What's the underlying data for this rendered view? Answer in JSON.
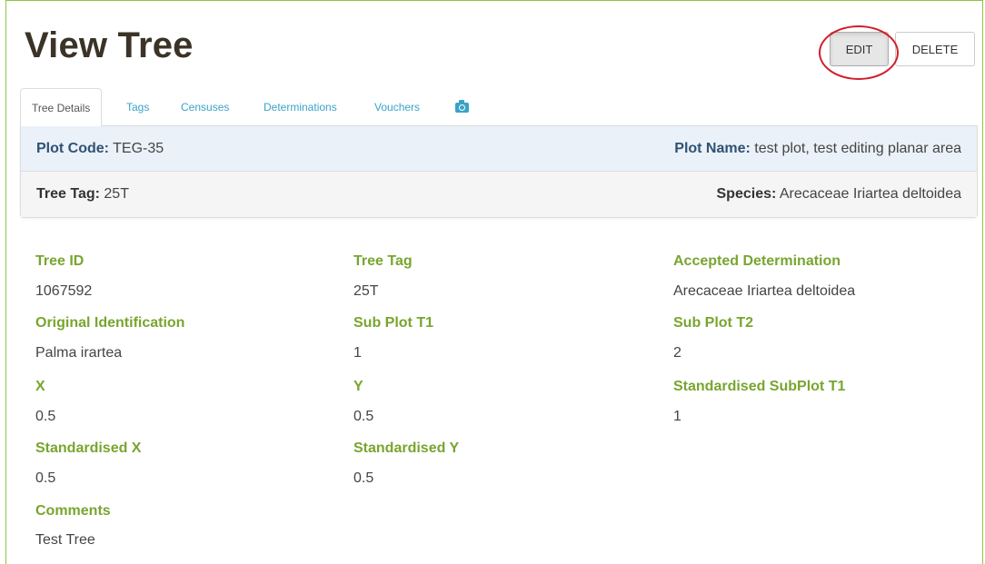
{
  "page": {
    "title": "View Tree",
    "edit_label": "EDIT",
    "delete_label": "DELETE"
  },
  "tabs": [
    {
      "label": "Tree Details",
      "active": true
    },
    {
      "label": "Tags",
      "active": false
    },
    {
      "label": "Censuses",
      "active": false
    },
    {
      "label": "Determinations",
      "active": false
    },
    {
      "label": "Vouchers",
      "active": false
    },
    {
      "icon": "camera-icon",
      "active": false
    }
  ],
  "summary": {
    "plot_code_label": "Plot Code:",
    "plot_code": "TEG-35",
    "plot_name_label": "Plot Name:",
    "plot_name": "test plot, test editing planar area",
    "tree_tag_label": "Tree Tag:",
    "tree_tag": "25T",
    "species_label": "Species:",
    "species": "Arecaceae Iriartea deltoidea"
  },
  "details": {
    "tree_id": {
      "label": "Tree ID",
      "value": "1067592"
    },
    "tree_tag": {
      "label": "Tree Tag",
      "value": "25T"
    },
    "accepted_determination": {
      "label": "Accepted Determination",
      "value": "Arecaceae Iriartea deltoidea"
    },
    "original_identification": {
      "label": "Original Identification",
      "value": "Palma irartea"
    },
    "sub_plot_t1": {
      "label": "Sub Plot T1",
      "value": "1"
    },
    "sub_plot_t2": {
      "label": "Sub Plot T2",
      "value": "2"
    },
    "x": {
      "label": "X",
      "value": "0.5"
    },
    "y": {
      "label": "Y",
      "value": "0.5"
    },
    "standardised_subplot_t1": {
      "label": "Standardised SubPlot T1",
      "value": "1"
    },
    "standardised_x": {
      "label": "Standardised X",
      "value": "0.5"
    },
    "standardised_y": {
      "label": "Standardised Y",
      "value": "0.5"
    },
    "comments": {
      "label": "Comments",
      "value": "Test Tree"
    }
  },
  "colors": {
    "accent_green": "#78a52f",
    "link_blue": "#3aa3c7",
    "annotation_red": "#d21e2b"
  }
}
